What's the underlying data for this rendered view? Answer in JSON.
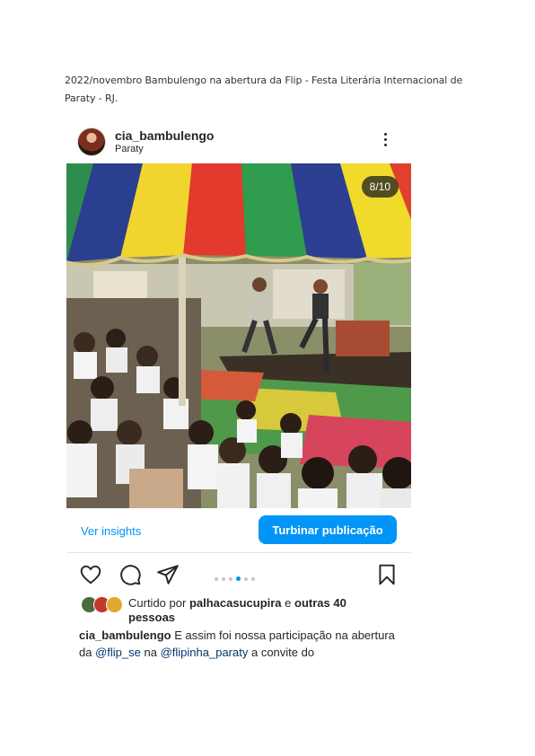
{
  "document": {
    "caption": "2022/novembro Bambulengo na abertura da Flip - Festa Literária Internacional de Paraty - RJ."
  },
  "post": {
    "username": "cia_bambulengo",
    "location": "Paraty",
    "counter": "8/10",
    "current_slide": 8,
    "total_slides": 10,
    "insights_label": "Ver insights",
    "boost_label": "Turbinar publicação",
    "likes": {
      "prefix": "Curtido por",
      "user": "palhacasucupira",
      "connector": "e",
      "others": "outras 40 pessoas"
    },
    "caption": {
      "user": "cia_bambulengo",
      "text1": "E assim foi nossa participação na abertura da",
      "mention1": "@flip_se",
      "text2": "na",
      "mention2": "@flipinha_paraty",
      "text3": "a convite do"
    }
  },
  "icons": [
    "more-vertical-icon",
    "heart-icon",
    "comment-icon",
    "share-icon",
    "bookmark-icon"
  ],
  "colors": {
    "accent": "#0095f6",
    "mention": "#00376b"
  }
}
